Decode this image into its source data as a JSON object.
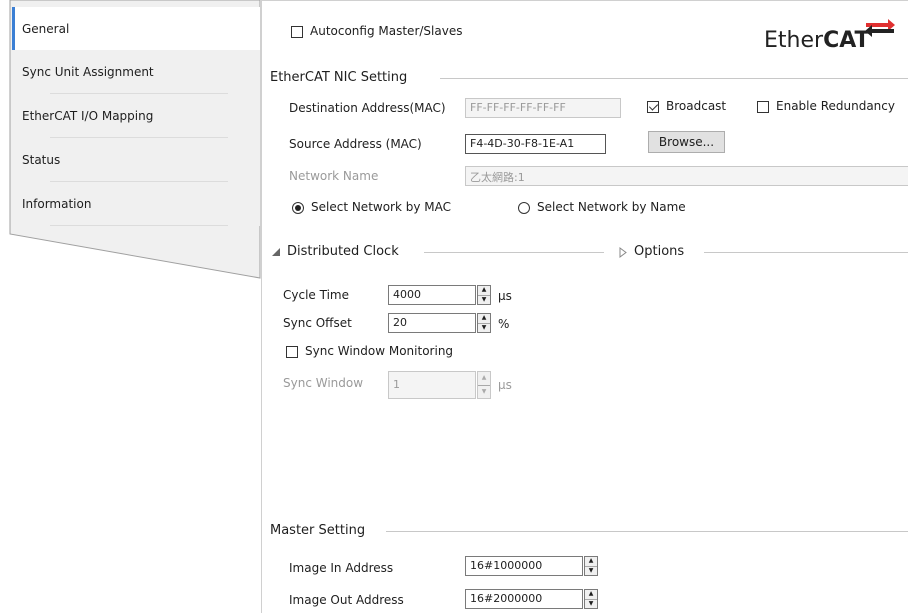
{
  "tabs": [
    {
      "label": "General",
      "active": true
    },
    {
      "label": "Sync Unit Assignment",
      "active": false
    },
    {
      "label": "EtherCAT I/O Mapping",
      "active": false
    },
    {
      "label": "Status",
      "active": false
    },
    {
      "label": "Information",
      "active": false
    }
  ],
  "autoconfig": {
    "label": "Autoconfig Master/Slaves",
    "checked": false
  },
  "logo": {
    "text_light": "Ether",
    "text_bold": "CAT",
    "accent_color": "#e03030"
  },
  "nic": {
    "section_title": "EtherCAT NIC Setting",
    "destination_label": "Destination Address(MAC)",
    "destination_value": "FF-FF-FF-FF-FF-FF",
    "broadcast_label": "Broadcast",
    "broadcast_checked": true,
    "redundancy_label": "Enable Redundancy",
    "redundancy_checked": false,
    "source_label": "Source Address (MAC)",
    "source_value": "F4-4D-30-F8-1E-A1",
    "browse_label": "Browse...",
    "network_name_label": "Network Name",
    "network_name_value": "乙太網路:1",
    "select_by_mac_label": "Select Network by MAC",
    "select_by_mac_checked": true,
    "select_by_name_label": "Select Network by Name",
    "select_by_name_checked": false
  },
  "dc": {
    "section_title": "Distributed Clock",
    "options_label": "Options",
    "cycle_time_label": "Cycle Time",
    "cycle_time_value": "4000",
    "cycle_time_unit": "µs",
    "sync_offset_label": "Sync Offset",
    "sync_offset_value": "20",
    "sync_offset_unit": "%",
    "sync_window_monitoring_label": "Sync Window Monitoring",
    "sync_window_monitoring_checked": false,
    "sync_window_label": "Sync Window",
    "sync_window_value": "1",
    "sync_window_unit": "µs"
  },
  "master": {
    "section_title": "Master Setting",
    "image_in_label": "Image In Address",
    "image_in_value": "16#1000000",
    "image_out_label": "Image Out Address",
    "image_out_value": "16#2000000"
  },
  "colors": {
    "active_tab_accent": "#3b7fd4",
    "tab_bg": "#f0f0f0"
  }
}
